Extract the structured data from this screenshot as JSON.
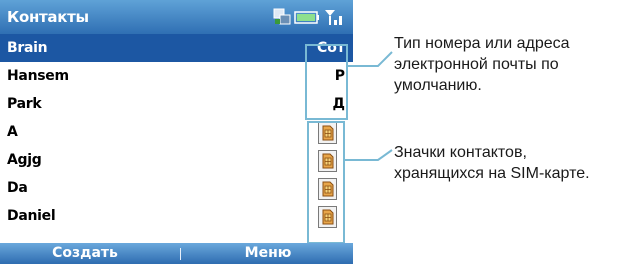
{
  "phone": {
    "title": "Контакты",
    "status_icons": [
      "sync-icon",
      "battery-icon",
      "signal-icon"
    ],
    "contacts": [
      {
        "name": "Brain",
        "tag": "Сот",
        "sim": false,
        "selected": true
      },
      {
        "name": "Hansem",
        "tag": "Р",
        "sim": false,
        "selected": false
      },
      {
        "name": "Park",
        "tag": "Д",
        "sim": false,
        "selected": false
      },
      {
        "name": "A",
        "tag": "",
        "sim": true,
        "selected": false
      },
      {
        "name": "Agjg",
        "tag": "",
        "sim": true,
        "selected": false
      },
      {
        "name": "Da",
        "tag": "",
        "sim": true,
        "selected": false
      },
      {
        "name": "Daniel",
        "tag": "",
        "sim": true,
        "selected": false
      }
    ],
    "softkeys": {
      "left": "Создать",
      "right": "Меню"
    }
  },
  "callouts": {
    "default_number": [
      "Тип номера или адреса",
      "электронной почты по",
      "умолчанию."
    ],
    "sim_icons": [
      "Значки контактов,",
      "хранящихся на SIM-карте."
    ]
  },
  "colors": {
    "titlebar": "#3f83c6",
    "selection": "#1c57a3",
    "callout_line": "#79b9d4"
  }
}
